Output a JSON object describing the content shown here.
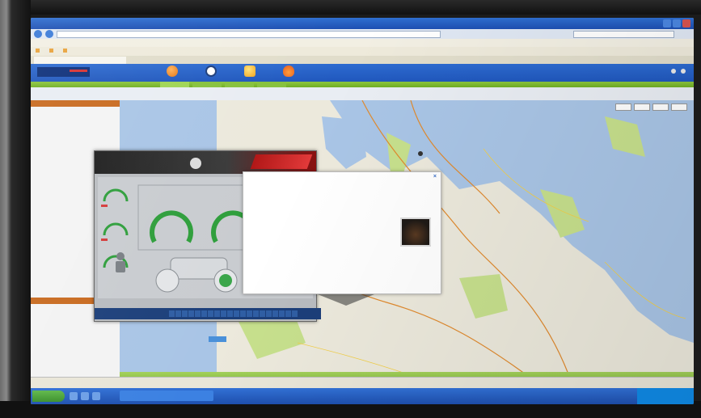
{
  "browser": {
    "title": "",
    "address": "",
    "search_placeholder": "",
    "menu_items": [
      "",
      "",
      "",
      "",
      ""
    ],
    "favorites": [
      "",
      "",
      ""
    ],
    "tab_label": "",
    "toolbar_items": [
      "",
      "",
      "",
      ""
    ]
  },
  "app": {
    "logo_text": "",
    "header_links": [
      "",
      ""
    ],
    "nav_icons": [
      "orange-circle-icon",
      "white-circle-icon",
      "yellow-folder-icon",
      "flame-icon"
    ],
    "subnav_tabs": [
      "",
      "",
      "",
      ""
    ]
  },
  "sidebar": {
    "panel1_title": "",
    "panel1_lines": [
      "",
      "",
      "",
      ""
    ],
    "panel2_title": "",
    "panel2_items": [
      "",
      "",
      "",
      "",
      "",
      ""
    ]
  },
  "map": {
    "tools": [
      "",
      "",
      "",
      ""
    ],
    "caption": ""
  },
  "dashboard": {
    "header_lines": [
      "",
      "",
      "",
      ""
    ],
    "footer_label": ""
  },
  "info": {
    "lines": [
      "",
      "",
      "",
      "",
      "",
      "",
      "",
      "",
      "",
      "",
      "",
      "",
      ""
    ]
  },
  "statusbar": {
    "zone": "",
    "zoom": ""
  },
  "taskbar": {
    "start": "",
    "window": "",
    "clock": ""
  },
  "colors": {
    "header_blue": "#2057bd",
    "accent_green": "#7fb834",
    "accent_orange": "#c86a1f",
    "gauge_green": "#2e9e3b",
    "alert_red": "#d43a3a"
  }
}
